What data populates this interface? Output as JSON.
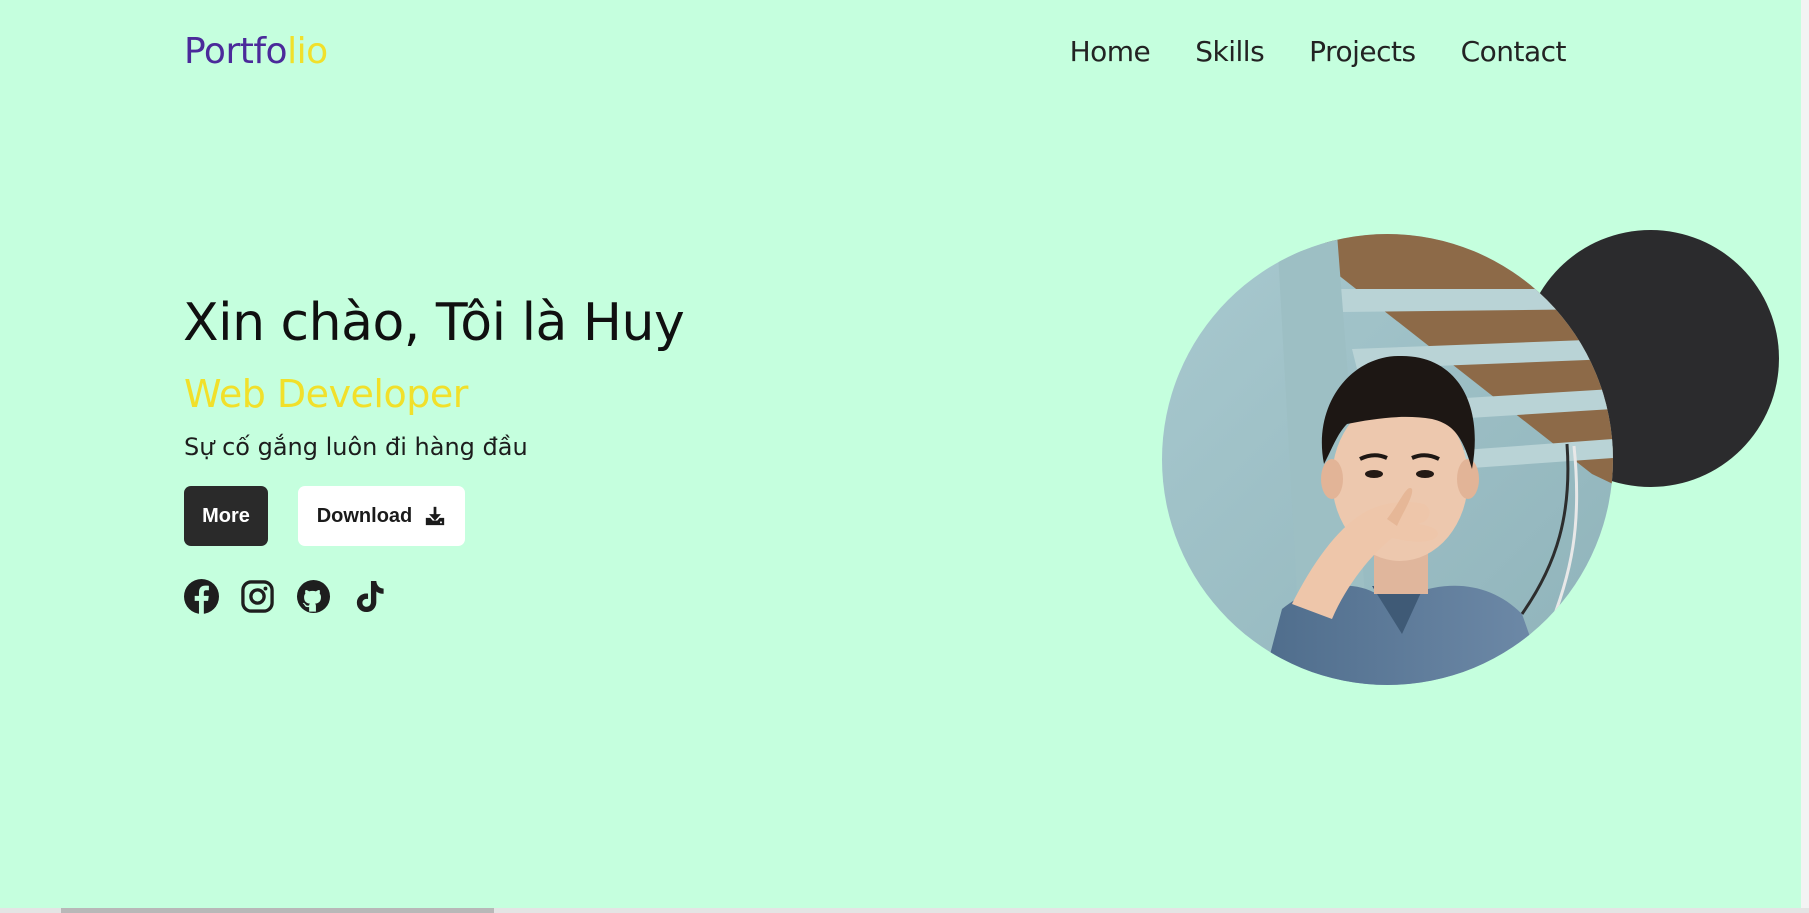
{
  "header": {
    "logo_main": "Portfo",
    "logo_accent": "lio",
    "nav": [
      "Home",
      "Skills",
      "Projects",
      "Contact"
    ]
  },
  "intro": {
    "greeting": "Xin chào, Tôi là Huy",
    "role": "Web Developer",
    "tagline": "Sự cố gắng luôn đi hàng đầu"
  },
  "buttons": {
    "more_label": "More",
    "download_label": "Download"
  },
  "socials": [
    "facebook-icon",
    "instagram-icon",
    "github-icon",
    "tiktok-icon"
  ],
  "colors": {
    "background": "#c5ffde",
    "logo": "#4b2a9a",
    "accent": "#f1e02a",
    "dark": "#2a2a2a"
  }
}
